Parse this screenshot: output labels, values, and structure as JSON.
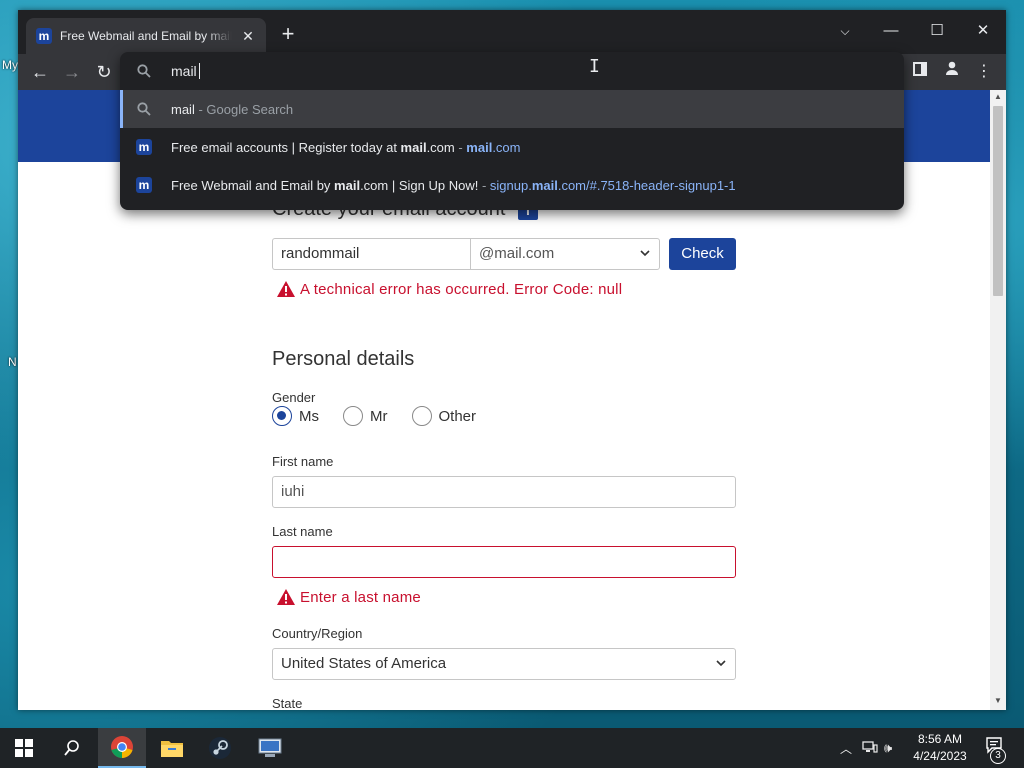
{
  "browser": {
    "tab_title": "Free Webmail and Email by mail.com | Sign Up Now!",
    "tab_favicon": "m",
    "new_tab_label": "+",
    "omnibox": {
      "query": "mail",
      "suggestions": [
        {
          "title": "mail",
          "separator": " - ",
          "detail": "Google Search",
          "icon": "search-icon"
        },
        {
          "title_pre": "Free email accounts | Register today at ",
          "title_bold": "mail",
          "title_post": ".com",
          "separator": " - ",
          "url_bold": "mail",
          "url_post": ".com",
          "icon": "mail-favicon"
        },
        {
          "title_pre": "Free Webmail and Email by ",
          "title_bold": "mail",
          "title_post": ".com | Sign Up Now!",
          "separator": " - ",
          "url_pre": "signup.",
          "url_bold": "mail",
          "url_post": ".com/#.7518-header-signup1-1",
          "icon": "mail-favicon"
        }
      ]
    }
  },
  "form": {
    "create_title": "Create your email account",
    "info_badge": "i",
    "email_local_value": "randommail",
    "email_domain": "@mail.com",
    "check_label": "Check",
    "email_error": "A technical error has occurred. Error Code: null",
    "personal_title": "Personal details",
    "gender_label": "Gender",
    "gender_options": [
      "Ms",
      "Mr",
      "Other"
    ],
    "gender_selected": "Ms",
    "first_name_label": "First name",
    "first_name_value": "iuhi",
    "last_name_label": "Last name",
    "last_name_value": "",
    "last_name_error": "Enter a last name",
    "country_label": "Country/Region",
    "country_value": "United States of America",
    "state_label": "State"
  },
  "desktop": {
    "labels": [
      "My",
      "N"
    ]
  },
  "taskbar": {
    "time": "8:56 AM",
    "date": "4/24/2023",
    "notification_count": "3",
    "apps": [
      "start-icon",
      "search-icon",
      "chrome-icon",
      "file-explorer-icon",
      "steam-icon",
      "network-app-icon"
    ]
  },
  "colors": {
    "brand": "#1c449b",
    "error": "#c8102e",
    "chrome_dark": "#202124",
    "link_blue": "#8ab4f8"
  }
}
